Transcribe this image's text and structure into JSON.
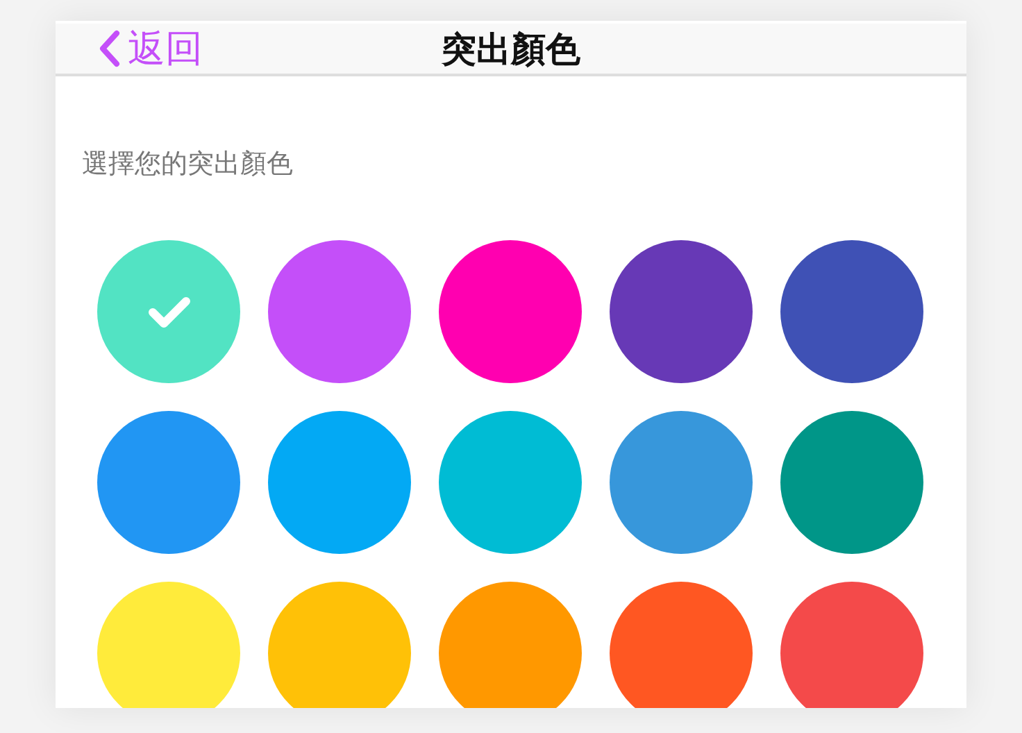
{
  "header": {
    "back_label": "返回",
    "title": "突出顏色"
  },
  "prompt": "選擇您的突出顏色",
  "swatches": [
    {
      "color": "#52e3c3",
      "selected": true
    },
    {
      "color": "#c44ff9",
      "selected": false
    },
    {
      "color": "#ff00b0",
      "selected": false
    },
    {
      "color": "#6739b6",
      "selected": false
    },
    {
      "color": "#3f51b5",
      "selected": false
    },
    {
      "color": "#2196f3",
      "selected": false
    },
    {
      "color": "#03a9f4",
      "selected": false
    },
    {
      "color": "#00bcd4",
      "selected": false
    },
    {
      "color": "#3797db",
      "selected": false
    },
    {
      "color": "#009688",
      "selected": false
    },
    {
      "color": "#ffeb3b",
      "selected": false
    },
    {
      "color": "#ffc107",
      "selected": false
    },
    {
      "color": "#ff9800",
      "selected": false
    },
    {
      "color": "#ff5722",
      "selected": false
    },
    {
      "color": "#f44a4a",
      "selected": false
    }
  ]
}
